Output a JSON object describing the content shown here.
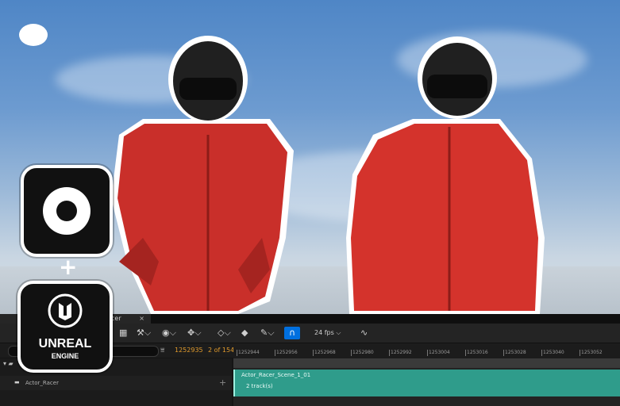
{
  "scene": {
    "background": "sky",
    "suit_color": "#c92f2a",
    "helmet_color": "#1f1f1f"
  },
  "tab": {
    "label": "cer",
    "close": "×"
  },
  "toolbar": {
    "snap_icon": "magnet-icon",
    "fps": "24 fps ⌵"
  },
  "status": {
    "frame": "1252935",
    "of": "2 of 154"
  },
  "ruler": {
    "ticks": [
      "1252944",
      "1252956",
      "1252968",
      "1252980",
      "1252992",
      "1253004",
      "1253016",
      "1253028",
      "1253040",
      "1253052"
    ]
  },
  "tree": {
    "actor": "Actor_Racer"
  },
  "shot": {
    "name": "Actor_Racer_Scene_1_01",
    "tracks": "2 track(s)"
  },
  "logos": {
    "ue_line1": "UNREAL",
    "ue_line2": "ENGINE",
    "plus": "+"
  }
}
